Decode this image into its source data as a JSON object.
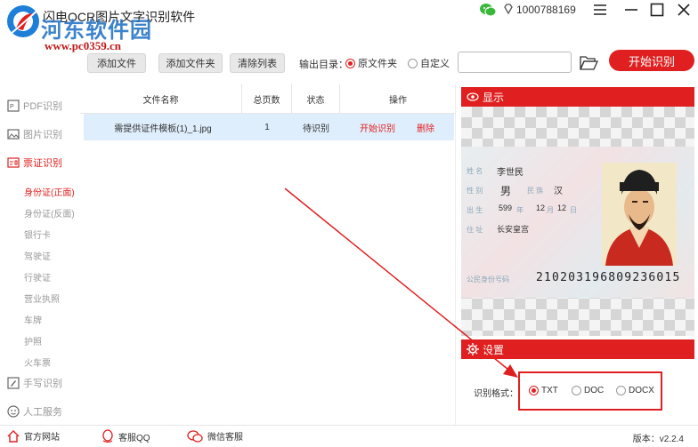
{
  "titlebar": {
    "app_title": "闪电OCR图片文字识别软件",
    "watermark_main": "河东软件园",
    "watermark_url": "www.pc0359.cn",
    "user_id": "1000788169",
    "icons": [
      "wechat-icon",
      "diamond-icon",
      "menu-icon",
      "minimize-icon",
      "maximize-icon",
      "close-icon"
    ]
  },
  "toolbar": {
    "add_file": "添加文件",
    "add_folder": "添加文件夹",
    "clear_list": "清除列表",
    "output_label": "输出目录：",
    "opt_source_folder": "原文件夹",
    "opt_custom": "自定义",
    "output_selected": "原文件夹",
    "path_value": "",
    "start_label": "开始识别"
  },
  "sidebar": {
    "categories": [
      {
        "label": "PDF识别",
        "icon": "pdf-icon",
        "active": false
      },
      {
        "label": "图片识别",
        "icon": "image-icon",
        "active": false
      },
      {
        "label": "票证识别",
        "icon": "card-icon",
        "active": true
      },
      {
        "label": "手写识别",
        "icon": "handwriting-icon",
        "active": false
      },
      {
        "label": "人工服务",
        "icon": "service-icon",
        "active": false
      }
    ],
    "subitems": [
      "身份证(正面)",
      "身份证(反面)",
      "银行卡",
      "驾驶证",
      "行驶证",
      "营业执照",
      "车牌",
      "护照",
      "火车票"
    ],
    "active_subitem": "身份证(正面)"
  },
  "table": {
    "headers": [
      "文件名称",
      "总页数",
      "状态",
      "操作"
    ],
    "rows": [
      {
        "name": "需提供证件模板(1)_1.jpg",
        "pages": "1",
        "status": "待识别",
        "action_start": "开始识别",
        "action_delete": "删除"
      }
    ]
  },
  "display": {
    "title": "显示",
    "card": {
      "name_label": "姓 名",
      "name": "李世民",
      "sex_label": "性 别",
      "sex": "男",
      "ethnic_label": "民 族",
      "ethnic": "汉",
      "birth_label": "出 生",
      "birth_year": "599",
      "birth_month": "12",
      "birth_day": "12",
      "year_label": "年",
      "month_label": "月",
      "day_label": "日",
      "address_label": "住 址",
      "address": "长安皇宫",
      "id_label": "公民身份号码",
      "id_number": "210203196809236015"
    }
  },
  "settings": {
    "title": "设置",
    "format_label": "识别格式：",
    "formats": [
      "TXT",
      "DOC",
      "DOCX"
    ],
    "selected_format": "TXT"
  },
  "footer": {
    "website": "官方网站",
    "qq": "客服QQ",
    "wechat": "微信客服",
    "version": "版本：v2.2.4"
  },
  "colors": {
    "accent": "#e02020",
    "row_selected": "#dfeefc",
    "wechat": "#3bb83b"
  }
}
